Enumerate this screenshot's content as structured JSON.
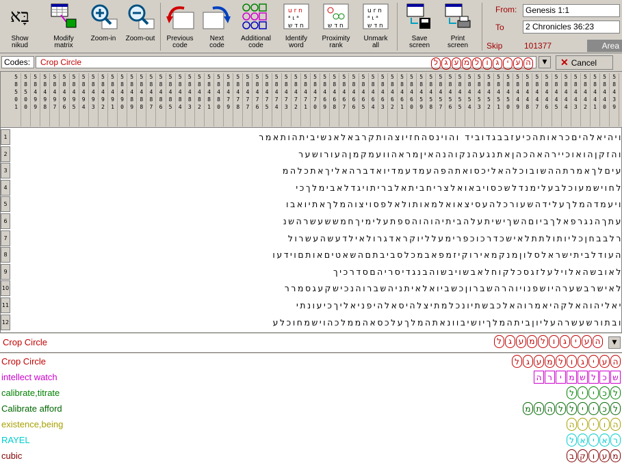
{
  "toolbar": {
    "buttons": [
      {
        "label": "Show\nnikud",
        "icon": "nikud-hebrew-icon"
      },
      {
        "label": "Modify\nmatrix",
        "icon": "matrix-grid-icon"
      },
      {
        "label": "Zoom-in",
        "icon": "zoom-in-icon"
      },
      {
        "label": "Zoom-out",
        "icon": "zoom-out-icon"
      },
      {
        "label": "Previous\ncode",
        "icon": "previous-code-icon"
      },
      {
        "label": "Next\ncode",
        "icon": "next-code-icon"
      },
      {
        "label": "Additional\ncode",
        "icon": "additional-code-icon"
      },
      {
        "label": "Identify\nword",
        "icon": "identify-word-icon"
      },
      {
        "label": "Proximity\nrank",
        "icon": "proximity-rank-icon"
      },
      {
        "label": "Unmark\nall",
        "icon": "unmark-all-icon"
      },
      {
        "label": "Save\nscreen",
        "icon": "save-screen-icon"
      },
      {
        "label": "Print\nscreen",
        "icon": "print-screen-icon"
      }
    ],
    "nikud_glyph": "בָּא",
    "from_label": "From:",
    "from_value": "Genesis 1:1",
    "to_label": "To",
    "to_value": "2 Chronicles 36:23",
    "skip_label": "Skip",
    "skip_value": "101377",
    "area_label": "Area"
  },
  "codes": {
    "label": "Codes:",
    "value": "Crop Circle",
    "hebrew": "העיגולמעגל",
    "cancel_label": "Cancel"
  },
  "grid": {
    "column_headers": [
      "5\n8\n5\n0\n1",
      "5\n8\n5\n0\n0",
      "5\n8\n4\n9\n9",
      "5\n8\n4\n9\n8",
      "5\n8\n4\n9\n7",
      "5\n8\n4\n9\n6",
      "5\n8\n4\n9\n5",
      "5\n8\n4\n9\n4",
      "5\n8\n4\n9\n3",
      "5\n8\n4\n9\n2",
      "5\n8\n4\n9\n1",
      "5\n8\n4\n9\n0",
      "5\n8\n4\n8\n9",
      "5\n8\n4\n8\n8",
      "5\n8\n4\n8\n7",
      "5\n8\n4\n8\n6",
      "5\n8\n4\n8\n5",
      "5\n8\n4\n8\n4",
      "5\n8\n4\n8\n3",
      "5\n8\n4\n8\n2",
      "5\n8\n4\n8\n1",
      "5\n8\n4\n8\n0",
      "5\n8\n4\n7\n9",
      "5\n8\n4\n7\n8",
      "5\n8\n4\n7\n7",
      "5\n8\n4\n7\n6",
      "5\n8\n4\n7\n5",
      "5\n8\n4\n7\n4",
      "5\n8\n4\n7\n3",
      "5\n8\n4\n7\n2",
      "5\n8\n4\n7\n1",
      "5\n8\n4\n7\n0",
      "5\n8\n4\n6\n9",
      "5\n8\n4\n6\n8",
      "5\n8\n4\n6\n7",
      "5\n8\n4\n6\n6",
      "5\n8\n4\n6\n5",
      "5\n8\n4\n6\n4",
      "5\n8\n4\n6\n3",
      "5\n8\n4\n6\n2",
      "5\n8\n4\n6\n1",
      "5\n8\n4\n6\n0",
      "5\n8\n4\n5\n9",
      "5\n8\n4\n5\n8",
      "5\n8\n4\n5\n7",
      "5\n8\n4\n5\n6",
      "5\n8\n4\n5\n5",
      "5\n8\n4\n5\n4",
      "5\n8\n4\n5\n3",
      "5\n8\n4\n5\n2",
      "5\n8\n4\n5\n1",
      "5\n8\n4\n5\n0",
      "5\n8\n4\n4\n9",
      "5\n8\n4\n4\n8",
      "5\n8\n4\n4\n7",
      "5\n8\n4\n4\n6",
      "5\n8\n4\n4\n5",
      "5\n8\n4\n4\n4",
      "5\n8\n4\n4\n3",
      "5\n8\n4\n4\n2",
      "5\n8\n4\n4\n1",
      "5\n8\n4\n4\n0",
      "5\n8\n4\n3\n9",
      "5\n8\n4\n3\n8"
    ],
    "rows": [
      {
        "num": "1",
        "text": "ויהיאלהיםכראותהכיעזבבגדוביד והוינסהחזיוצהותקרבאלאנשיביתהותאמר"
      },
      {
        "num": "2",
        "text": "והזקןהואוכיירהאהכהןאתנגעהנקוהנהאיןמראהוועמקמןהעורושער"
      },
      {
        "num": "3",
        "text": "עיםלךאמרתההשובוכלהאליכסואתהפהעמדעמדיואדברהאליךאתכלהמ"
      },
      {
        "num": "4",
        "text": "לחוישמעוכלבעלימנדלשכסויבאואלצריחביתאלבריתויגדלאבימלךכי"
      },
      {
        "num": "5",
        "text": "ויעמדהמלךעלידהשעורכלהעסיצאואלמאותולאלפסויצוהמלךאתיואבו"
      },
      {
        "num": "6",
        "text": "עתךהנגרפאלךביוםהשךישיתעלהביתיהוהוהספתעלימיךחמששעשרהשנ"
      },
      {
        "num": "7",
        "text": "רלבבחןכליותולתתלאישכדרכוכפרימעלליוקראדגרולאילדעשהעשרול"
      },
      {
        "num": "8",
        "text": "העודלביתישראלסלוןמנקמאירוקיזמפאבמכלסביבתםהשאטיםאותםוידעו"
      },
      {
        "num": "9",
        "text": "לאובשהאלוילעלזגסכלקוחלאבשויבשוהבנגדיסריהםסדרכיך"
      },
      {
        "num": "10",
        "text": "לאישרבשערהיושפנויוהרהשברוןכשביואלאיתניהשברוהנכישקעגסמרר"
      },
      {
        "num": "11",
        "text": "יאליהוהאלקהיאמרוהאלכבשתיונכלמתיצלהיסאלהיפניאליךכיעונתי"
      },
      {
        "num": "12",
        "text": "ובתורשעשרהעליוןביתהמלךיושיבוונאתהמלךעלכסאהממלכהוישמחוכלע"
      }
    ]
  },
  "match": {
    "label": "Crop Circle",
    "hebrew": "העיגולמעגל"
  },
  "terms": [
    {
      "label": "Crop Circle",
      "color": "#c00000",
      "letters": [
        "ה",
        "ע",
        "י",
        "ג",
        "ו",
        "ל",
        "מ",
        "ע",
        "ג",
        "ל"
      ],
      "style": "round"
    },
    {
      "label": "intellect watch",
      "color": "#cc00cc",
      "letters": [
        "ש",
        "כ",
        "ל",
        "ש",
        "מ",
        "י",
        "ר",
        "ה"
      ],
      "style": "box"
    },
    {
      "label": "calibrate,titrate",
      "color": "#008000",
      "letters": [
        "ל",
        "כ",
        "י",
        "י",
        "ל"
      ],
      "style": "round"
    },
    {
      "label": "Calibrate afford",
      "color": "#006600",
      "letters": [
        "ל",
        "כ",
        "י",
        "י",
        "ל",
        "ל",
        "ה",
        "ת",
        "מ"
      ],
      "style": "round"
    },
    {
      "label": "existence,being",
      "color": "#a8a000",
      "letters": [
        "ה",
        "ו",
        "י",
        "י",
        "ה"
      ],
      "style": "round"
    },
    {
      "label": "RAYEL",
      "color": "#00cccc",
      "letters": [
        "ר",
        "א",
        "י",
        "א",
        "ל"
      ],
      "style": "round"
    },
    {
      "label": "cubic",
      "color": "#800000",
      "letters": [
        "מ",
        "ע",
        "ו",
        "ק",
        "ב"
      ],
      "style": "round"
    }
  ]
}
